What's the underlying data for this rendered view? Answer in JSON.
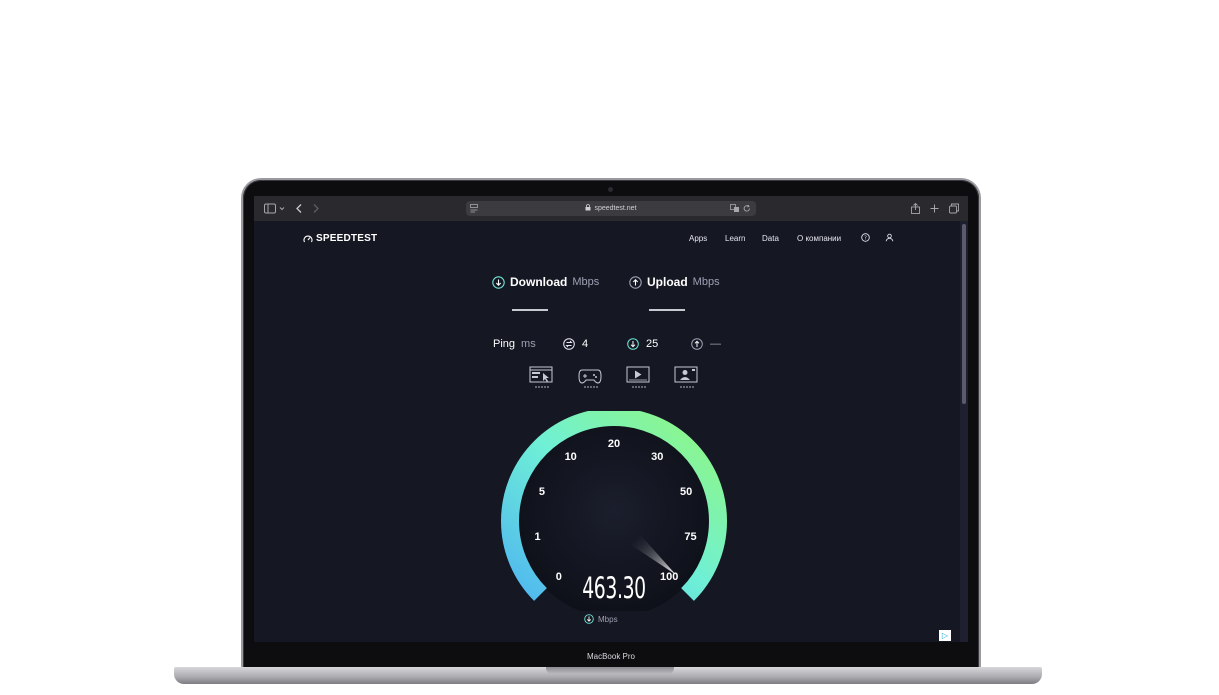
{
  "browser": {
    "url": "speedtest.net",
    "sidebar_icon": "sidebar-icon",
    "back_icon": "chevron-left-icon",
    "forward_icon": "chevron-right-icon",
    "share_icon": "share-icon",
    "new_tab_icon": "plus-icon",
    "tabs_icon": "tabs-icon"
  },
  "header": {
    "logo": "SPEEDTEST",
    "nav": [
      "Apps",
      "Learn",
      "Data",
      "О компании"
    ]
  },
  "metrics": {
    "download": {
      "label": "Download",
      "unit": "Mbps"
    },
    "upload": {
      "label": "Upload",
      "unit": "Mbps"
    }
  },
  "ping": {
    "label": "Ping",
    "unit": "ms",
    "idle": "4",
    "download": "25",
    "upload": "—"
  },
  "gauge": {
    "ticks": [
      "0",
      "1",
      "5",
      "10",
      "20",
      "30",
      "50",
      "75",
      "100"
    ],
    "value": "463.30",
    "unit": "Mbps",
    "colors": {
      "start": "#4fb6f0",
      "mid": "#6ff0d6",
      "end": "#92f77b"
    }
  },
  "device": {
    "model": "MacBook Pro"
  },
  "ad_badge": "▷"
}
